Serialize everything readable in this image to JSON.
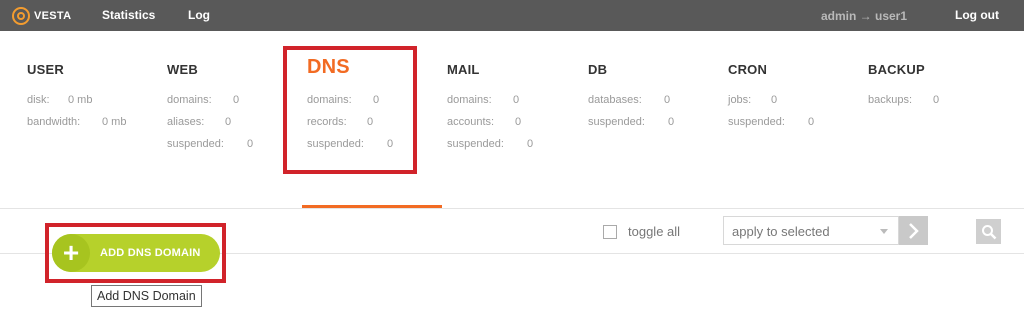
{
  "topbar": {
    "logo_text": "VESTA",
    "nav": [
      {
        "label": "Statistics"
      },
      {
        "label": "Log"
      }
    ],
    "user_info": "admin → user1",
    "logout_label": "Log out"
  },
  "panels": {
    "user": {
      "title": "USER",
      "stats": [
        {
          "label": "disk:",
          "value": "0 mb"
        },
        {
          "label": "bandwidth:",
          "value": "0 mb"
        }
      ]
    },
    "web": {
      "title": "WEB",
      "stats": [
        {
          "label": "domains:",
          "value": "0"
        },
        {
          "label": "aliases:",
          "value": "0"
        },
        {
          "label": "suspended:",
          "value": "0"
        }
      ]
    },
    "dns": {
      "title": "DNS",
      "stats": [
        {
          "label": "domains:",
          "value": "0"
        },
        {
          "label": "records:",
          "value": "0"
        },
        {
          "label": "suspended:",
          "value": "0"
        }
      ]
    },
    "mail": {
      "title": "MAIL",
      "stats": [
        {
          "label": "domains:",
          "value": "0"
        },
        {
          "label": "accounts:",
          "value": "0"
        },
        {
          "label": "suspended:",
          "value": "0"
        }
      ]
    },
    "db": {
      "title": "DB",
      "stats": [
        {
          "label": "databases:",
          "value": "0"
        },
        {
          "label": "suspended:",
          "value": "0"
        }
      ]
    },
    "cron": {
      "title": "CRON",
      "stats": [
        {
          "label": "jobs:",
          "value": "0"
        },
        {
          "label": "suspended:",
          "value": "0"
        }
      ]
    },
    "backup": {
      "title": "BACKUP",
      "stats": [
        {
          "label": "backups:",
          "value": "0"
        }
      ]
    }
  },
  "toolbar": {
    "add_button_label": "ADD DNS DOMAIN",
    "add_button_tooltip": "Add DNS Domain",
    "toggle_all_label": "toggle all",
    "bulk_action_selected": "apply to selected"
  },
  "icons": {
    "logo": "vesta-logo-icon",
    "add": "plus-icon",
    "apply": "chevron-right-icon",
    "search": "search-icon",
    "dropdown": "caret-down-icon"
  },
  "colors": {
    "topbar": "#595959",
    "accent": "#f26b23",
    "add_button": "#b6d12b",
    "highlight": "#d1232a"
  }
}
